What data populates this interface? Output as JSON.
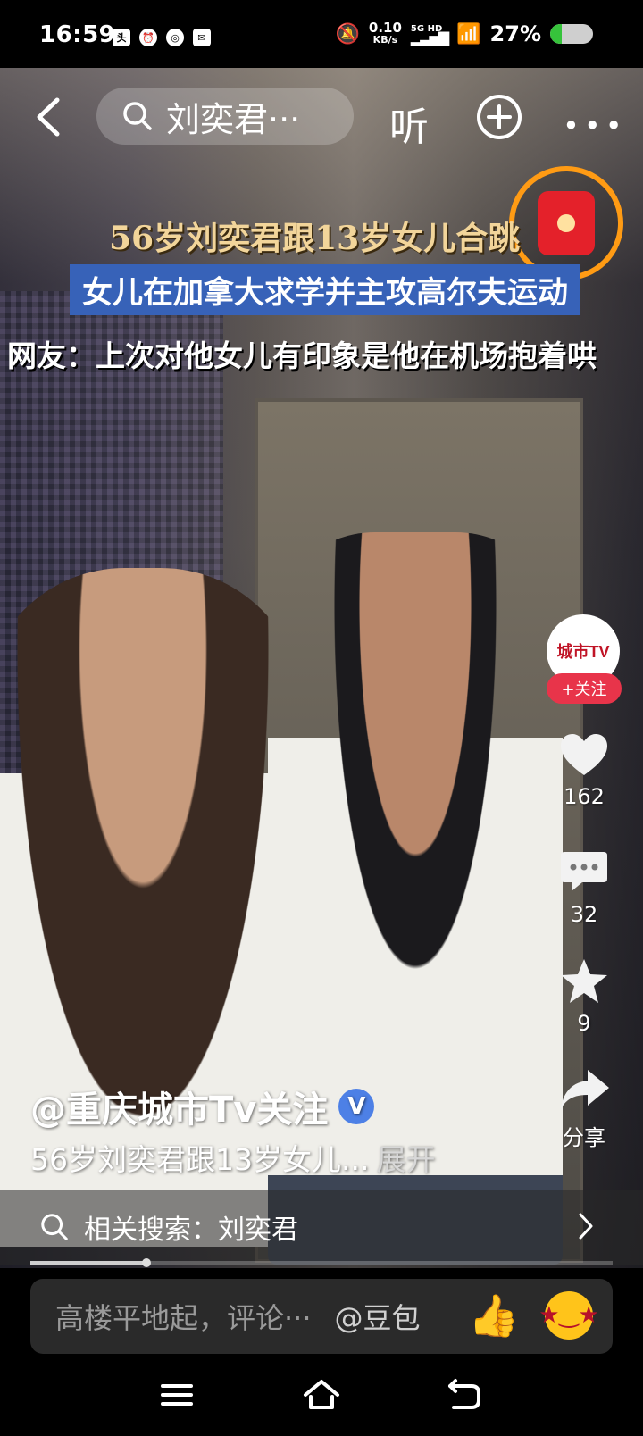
{
  "status_bar": {
    "time": "16:59",
    "left_icons": [
      "toutiao-icon",
      "alarm-icon",
      "sync-icon",
      "message-icon"
    ],
    "net_speed_value": "0.10",
    "net_speed_unit": "KB/s",
    "network_type": "5G HD",
    "battery_text": "27%",
    "battery_level": 0.27,
    "battery_color": "#36c33b"
  },
  "top_bar": {
    "search_query": "刘奕君···",
    "listen_label": "听"
  },
  "captions": {
    "line1": "56岁刘奕君跟13岁女儿合跳",
    "line2": "女儿在加拿大求学并主攻高尔夫运动",
    "line3": "网友：上次对他女儿有印象是他在机场抱着哄"
  },
  "creator": {
    "avatar_text": "城市TV",
    "follow_label": "+关注",
    "handle": "@重庆城市Tv关注",
    "verified_mark": "V"
  },
  "actions": {
    "likes": "162",
    "comments": "32",
    "favorites": "9",
    "share_label": "分享"
  },
  "post": {
    "description": "56岁刘奕君跟13岁女儿...",
    "expand_label": "展开"
  },
  "related_search": {
    "label": "相关搜索：刘奕君"
  },
  "playback": {
    "progress": 0.2
  },
  "comment_bar": {
    "placeholder": "高楼平地起，评论···",
    "mention": "@豆包"
  },
  "colors": {
    "accent_red": "#e8344a",
    "redpacket_ring": "#ff9b14",
    "caption_highlight": "#3762b8",
    "verified_blue": "#4d80e6"
  }
}
